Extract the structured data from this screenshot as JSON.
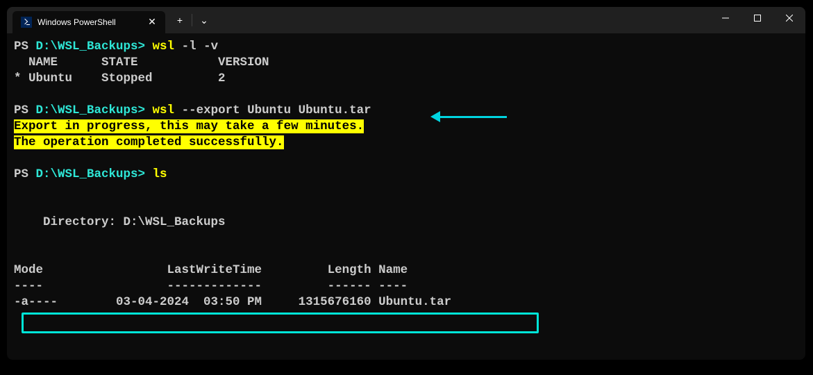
{
  "tab": {
    "title": "Windows PowerShell",
    "close": "✕",
    "new": "+",
    "dropdown": "⌄"
  },
  "winctl": {
    "min": "−",
    "max": "▢",
    "close": "✕"
  },
  "session": {
    "prompt1_ps": "PS ",
    "prompt1_path": "D:\\WSL_Backups>",
    "cmd1": " wsl",
    "args1": " -l -v",
    "list_header": "  NAME      STATE           VERSION",
    "list_row": "* Ubuntu    Stopped         2",
    "prompt2_ps": "PS ",
    "prompt2_path": "D:\\WSL_Backups>",
    "cmd2": " wsl",
    "args2": " --export Ubuntu Ubuntu.tar",
    "export_msg1": "Export in progress, this may take a few minutes.",
    "export_msg2": "The operation completed successfully.",
    "prompt3_ps": "PS ",
    "prompt3_path": "D:\\WSL_Backups>",
    "cmd3": " ls",
    "dir_label": "    Directory: D:\\WSL_Backups",
    "tbl_header": "Mode                 LastWriteTime         Length Name",
    "tbl_dash": "----                 -------------         ------ ----",
    "tbl_row": "-a----        03-04-2024  03:50 PM     1315676160 Ubuntu.tar"
  }
}
